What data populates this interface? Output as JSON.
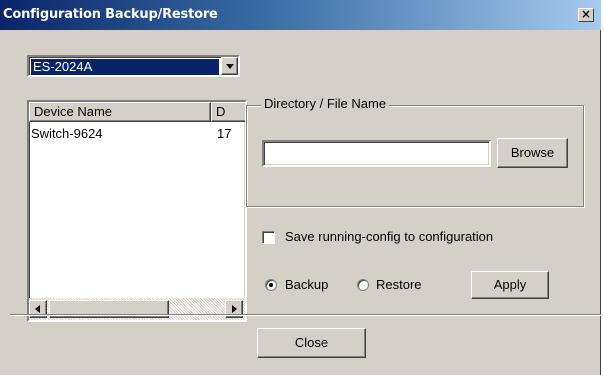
{
  "window": {
    "title": "Configuration Backup/Restore",
    "close_glyph": "×"
  },
  "device_select": {
    "value": "ES-2024A"
  },
  "device_list": {
    "columns": [
      "Device Name",
      "D"
    ],
    "rows": [
      [
        "Switch-9624",
        "17"
      ]
    ]
  },
  "file_group": {
    "legend": "Directory / File Name",
    "path_value": "",
    "browse_label": "Browse"
  },
  "options": {
    "save_running_config_label": "Save running-config to configuration",
    "save_running_config_checked": false,
    "mode_options": [
      "Backup",
      "Restore"
    ],
    "mode_selected": "Backup",
    "apply_label": "Apply"
  },
  "footer": {
    "close_label": "Close"
  },
  "icons": {
    "dropdown": "chevron-down-icon",
    "scroll_left": "arrow-left-icon",
    "scroll_right": "arrow-right-icon",
    "close": "close-icon"
  },
  "colors": {
    "title_bar": "#0a246a",
    "window_face": "#d4d0c8",
    "selection": "#0a246a"
  }
}
